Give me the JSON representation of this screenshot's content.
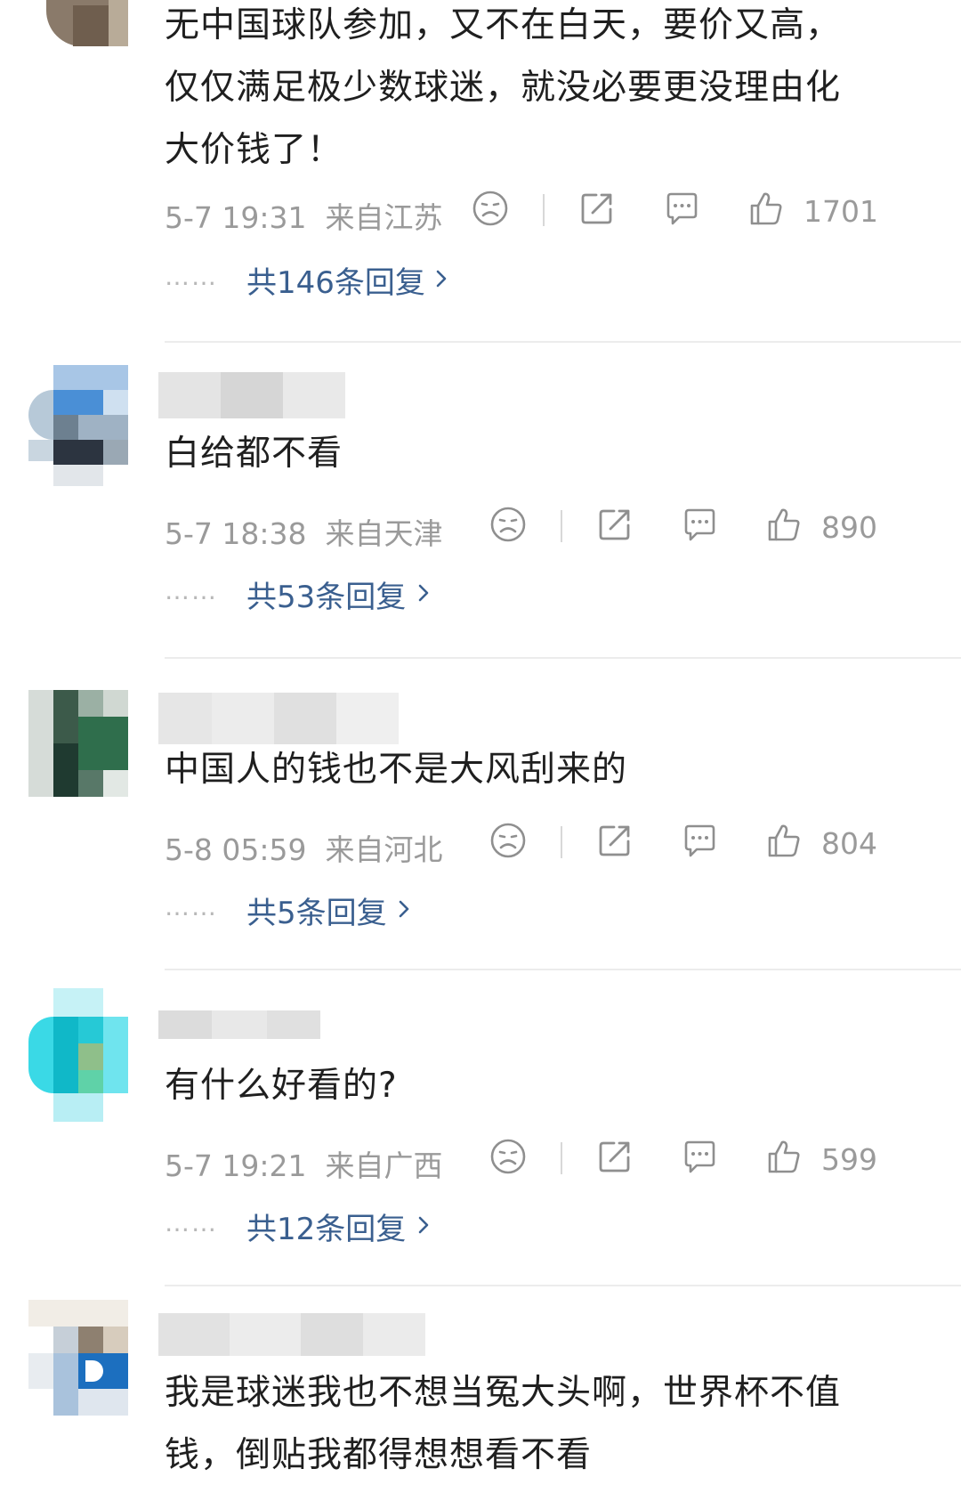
{
  "comments": [
    {
      "username": "",
      "text_lines": [
        "无中国球队参加，又不在白天，要价又高，",
        "仅仅满足极少数球迷，就没必要更没理由化",
        "大价钱了！"
      ],
      "time": "5-7 19:31",
      "location": "来自江苏",
      "likes": "1701",
      "replies": "共146条回复"
    },
    {
      "username": "",
      "text_lines": [
        "白给都不看"
      ],
      "time": "5-7 18:38",
      "location": "来自天津",
      "likes": "890",
      "replies": "共53条回复"
    },
    {
      "username": "",
      "text_lines": [
        "中国人的钱也不是大风刮来的"
      ],
      "time": "5-8 05:59",
      "location": "来自河北",
      "likes": "804",
      "replies": "共5条回复"
    },
    {
      "username": "",
      "text_lines": [
        "有什么好看的?"
      ],
      "time": "5-7 19:21",
      "location": "来自广西",
      "likes": "599",
      "replies": "共12条回复"
    },
    {
      "username": "",
      "text_lines": [
        "我是球迷我也不想当冤大头啊，世界杯不值",
        "钱，倒贴我都得想想看不看"
      ],
      "time": "",
      "location": "",
      "likes": "",
      "replies": ""
    }
  ],
  "ui": {
    "reply_dots": "……",
    "icons": [
      "sad-face-icon",
      "share-icon",
      "comment-icon",
      "thumbs-up-icon",
      "chevron-right-icon"
    ],
    "colors": {
      "link": "#3a5f8f",
      "meta": "#9a9a9a",
      "text": "#1f1f1f"
    }
  }
}
